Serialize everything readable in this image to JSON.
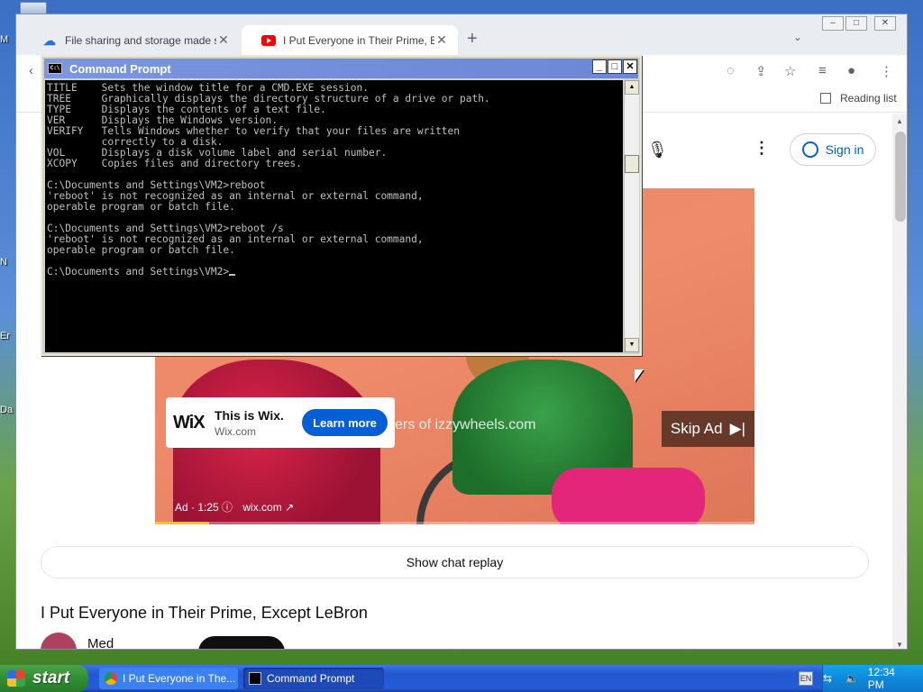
{
  "desktop": {
    "labels": [
      "M",
      "N",
      "Er",
      "Da"
    ]
  },
  "browser": {
    "tabs": [
      {
        "title": "File sharing and storage made simple",
        "icon": "cloud-icon",
        "active": false
      },
      {
        "title": "I Put Everyone in Their Prime, Except LeBron",
        "icon": "youtube-icon",
        "active": true
      }
    ],
    "new_tab": "+",
    "reading_list": "Reading list",
    "sign_in": "Sign in",
    "ad": {
      "brand_logo": "WiX",
      "card_title": "This is Wix.",
      "card_domain": "Wix.com",
      "cta": "Learn more",
      "overlay_text": "ers of izzywheels.com",
      "skip": "Skip Ad",
      "info": "Ad · 1:25",
      "site": "wix.com",
      "progress": 0.09
    },
    "show_chat_replay": "Show chat replay",
    "video_title": "I Put Everyone in Their Prime, Except LeBron",
    "channel_name": "Med"
  },
  "cmd": {
    "title": "Command Prompt",
    "lines": [
      "TITLE    Sets the window title for a CMD.EXE session.",
      "TREE     Graphically displays the directory structure of a drive or path.",
      "TYPE     Displays the contents of a text file.",
      "VER      Displays the Windows version.",
      "VERIFY   Tells Windows whether to verify that your files are written",
      "         correctly to a disk.",
      "VOL      Displays a disk volume label and serial number.",
      "XCOPY    Copies files and directory trees.",
      "",
      "C:\\Documents and Settings\\VM2>reboot",
      "'reboot' is not recognized as an internal or external command,",
      "operable program or batch file.",
      "",
      "C:\\Documents and Settings\\VM2>reboot /s",
      "'reboot' is not recognized as an internal or external command,",
      "operable program or batch file.",
      "",
      "C:\\Documents and Settings\\VM2>"
    ]
  },
  "taskbar": {
    "start": "start",
    "tasks": [
      {
        "label": "I Put Everyone in The...",
        "icon": "chrome-icon"
      },
      {
        "label": "Command Prompt",
        "icon": "cmd-icon"
      }
    ],
    "clock": "12:34 PM"
  },
  "colors": {
    "youtube_red": "#ff0000",
    "link_blue": "#065fd4",
    "xp_taskbar": "#245dd7",
    "xp_start_green": "#2f8e2f"
  }
}
